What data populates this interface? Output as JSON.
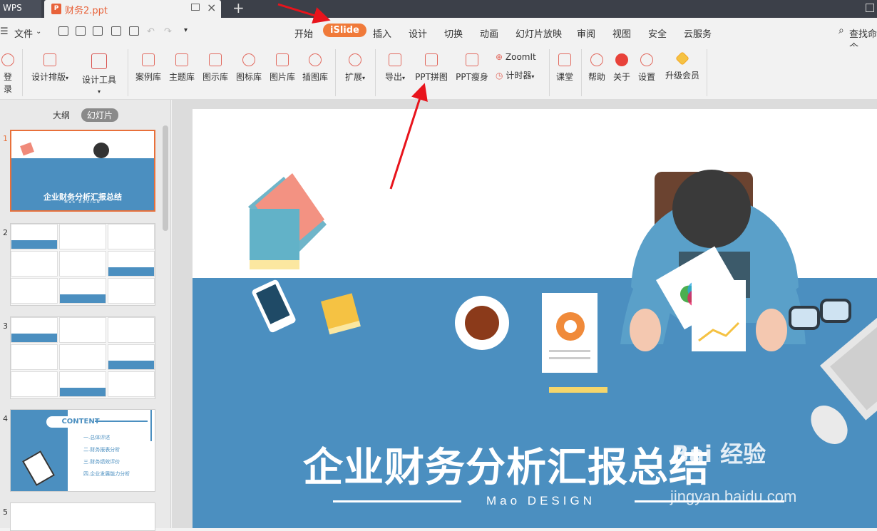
{
  "titlebar": {
    "app_tab": "WPS",
    "file_tab": "财务2.ppt",
    "file_icon": "P",
    "new_tab": "+"
  },
  "menubar": {
    "left": [
      "文件"
    ],
    "items": [
      "开始",
      "iSlide",
      "插入",
      "设计",
      "切换",
      "动画",
      "幻灯片放映",
      "审阅",
      "视图",
      "安全",
      "云服务"
    ],
    "active": "iSlide",
    "search": "查找命令"
  },
  "ribbon": {
    "buttons": [
      "登录",
      "设计排版",
      "设计工具",
      "案例库",
      "主题库",
      "图示库",
      "图标库",
      "图片库",
      "插图库",
      "扩展",
      "导出",
      "PPT拼图",
      "PPT瘦身",
      "ZoomIt",
      "计时器",
      "课堂",
      "帮助",
      "关于",
      "设置",
      "升级会员"
    ]
  },
  "panel": {
    "tabs": [
      "大纲",
      "幻灯片"
    ],
    "selected": "幻灯片",
    "slide_numbers": [
      "1",
      "2",
      "3",
      "4",
      "5"
    ]
  },
  "thumb1": {
    "title": "企业财务分析汇报总结",
    "sub": "Mao DESIGN"
  },
  "thumb4": {
    "content": "CONTENT",
    "items": [
      "一.总体评述",
      "二.财务报表分析",
      "三.财务绩效评价",
      "四.企业发展能力分析"
    ]
  },
  "slide": {
    "title": "企业财务分析汇报总结",
    "subtitle": "Mao DESIGN"
  },
  "watermark": {
    "line1": "Bai 经验",
    "line2": "jingyan.baidu.com"
  },
  "colors": {
    "accent": "#f07a3a",
    "slide_blue": "#4b8fc0",
    "arrow": "#e8141c"
  }
}
